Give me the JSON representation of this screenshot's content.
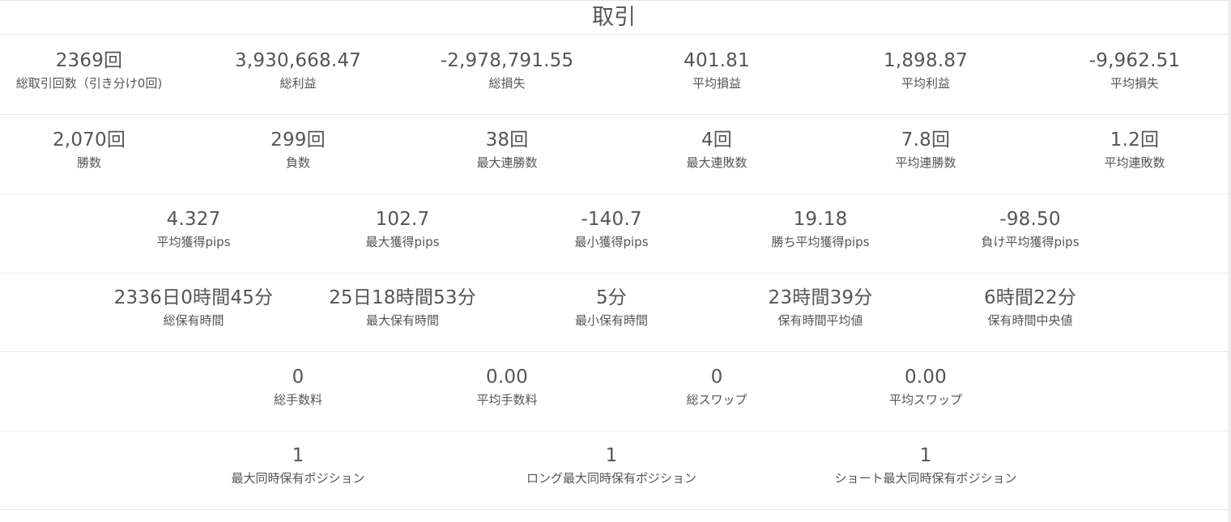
{
  "title": "取引",
  "rows": [
    [
      {
        "value": "2369回",
        "label": "総取引回数（引き分け0回)"
      },
      {
        "value": "3,930,668.47",
        "label": "総利益"
      },
      {
        "value": "-2,978,791.55",
        "label": "総損失"
      },
      {
        "value": "401.81",
        "label": "平均損益"
      },
      {
        "value": "1,898.87",
        "label": "平均利益"
      },
      {
        "value": "-9,962.51",
        "label": "平均損失"
      }
    ],
    [
      {
        "value": "2,070回",
        "label": "勝数"
      },
      {
        "value": "299回",
        "label": "負数"
      },
      {
        "value": "38回",
        "label": "最大連勝数"
      },
      {
        "value": "4回",
        "label": "最大連敗数"
      },
      {
        "value": "7.8回",
        "label": "平均連勝数"
      },
      {
        "value": "1.2回",
        "label": "平均連敗数"
      }
    ],
    [
      {
        "value": "4.327",
        "label": "平均獲得pips"
      },
      {
        "value": "102.7",
        "label": "最大獲得pips"
      },
      {
        "value": "-140.7",
        "label": "最小獲得pips"
      },
      {
        "value": "19.18",
        "label": "勝ち平均獲得pips"
      },
      {
        "value": "-98.50",
        "label": "負け平均獲得pips"
      }
    ],
    [
      {
        "value": "2336日0時間45分",
        "label": "総保有時間"
      },
      {
        "value": "25日18時間53分",
        "label": "最大保有時間"
      },
      {
        "value": "5分",
        "label": "最小保有時間"
      },
      {
        "value": "23時間39分",
        "label": "保有時間平均値"
      },
      {
        "value": "6時間22分",
        "label": "保有時間中央値"
      }
    ],
    [
      {
        "value": "0",
        "label": "総手数料"
      },
      {
        "value": "0.00",
        "label": "平均手数料"
      },
      {
        "value": "0",
        "label": "総スワップ"
      },
      {
        "value": "0.00",
        "label": "平均スワップ"
      }
    ],
    [
      {
        "value": "1",
        "label": "最大同時保有ポジション"
      },
      {
        "value": "1",
        "label": "ロング最大同時保有ポジション"
      },
      {
        "value": "1",
        "label": "ショート最大同時保有ポジション"
      }
    ]
  ]
}
